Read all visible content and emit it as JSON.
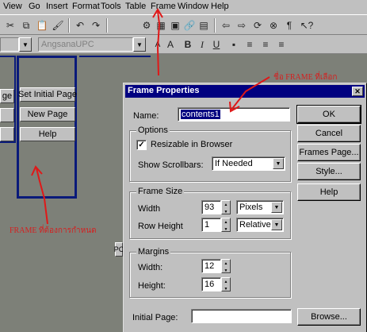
{
  "menu": {
    "items": [
      {
        "label": "View"
      },
      {
        "label": "Go"
      },
      {
        "label": "Insert"
      },
      {
        "label": "Format"
      },
      {
        "label": "Tools"
      },
      {
        "label": "Table"
      },
      {
        "label": "Frame"
      },
      {
        "label": "Window"
      },
      {
        "label": "Help"
      }
    ]
  },
  "toolbar": {
    "font_name": "AngsanaUPC",
    "bold": "B",
    "italic": "I",
    "underline": "U",
    "paragraph": "¶"
  },
  "frames": {
    "left_button_partial": "ge",
    "buttons": [
      {
        "label": "Set Initial Page"
      },
      {
        "label": "New Page"
      },
      {
        "label": "Help"
      }
    ],
    "left_partial_pc": "PC"
  },
  "annotations": {
    "frame_name_note": "ชื่อ FRAME ที่เลือก",
    "frame_to_set_note": "FRAME ที่ต้องการกำหนด",
    "color": "#d42020"
  },
  "dialog": {
    "title": "Frame Properties",
    "name_label": "Name:",
    "name_value": "contents1",
    "options_title": "Options",
    "resizable_label": "Resizable in Browser",
    "resizable_checked": "✓",
    "scrollbars_label": "Show Scrollbars:",
    "scrollbars_value": "If Needed",
    "frame_size_title": "Frame Size",
    "width_label": "Width",
    "width_value": "93",
    "width_unit": "Pixels",
    "row_height_label": "Row Height",
    "row_height_value": "1",
    "row_height_unit": "Relative",
    "margins_title": "Margins",
    "margin_width_label": "Width:",
    "margin_width_value": "12",
    "margin_height_label": "Height:",
    "margin_height_value": "16",
    "initial_page_label": "Initial Page:",
    "initial_page_value": "",
    "buttons": {
      "ok": "OK",
      "cancel": "Cancel",
      "frames_page": "Frames Page...",
      "style": "Style...",
      "help": "Help",
      "browse": "Browse..."
    }
  }
}
